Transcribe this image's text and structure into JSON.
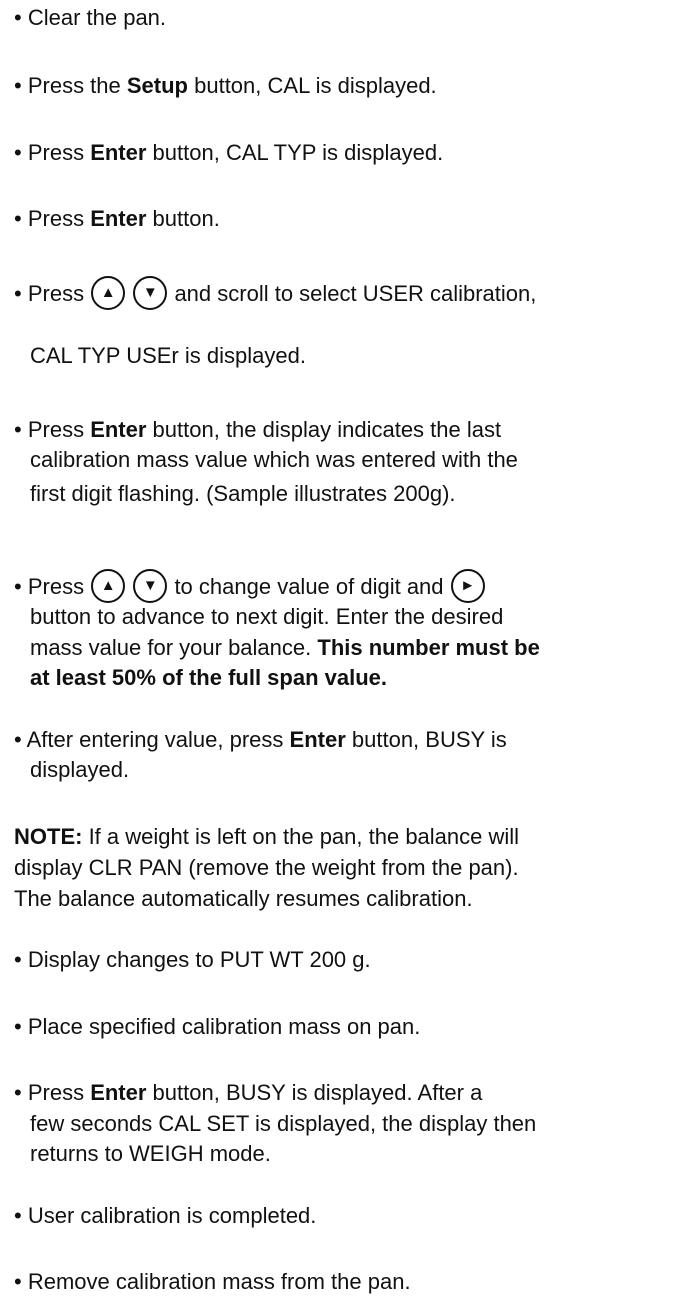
{
  "bullet": "•",
  "steps": {
    "s1": "Clear the pan.",
    "s2": {
      "pre": "Press the ",
      "bold": "Setup",
      "post": " button, CAL is displayed."
    },
    "s3": {
      "pre": "Press ",
      "bold": "Enter",
      "post": " button, CAL TYP is displayed."
    },
    "s4": {
      "pre": "Press ",
      "bold": "Enter",
      "post": " button."
    },
    "s5": {
      "pre": "Press",
      "post": " and scroll to select USER calibration,",
      "line2": "CAL TYP USEr is displayed."
    },
    "s6": {
      "pre": "Press ",
      "bold": "Enter",
      "post": " button, the display indicates the last",
      "line2": "calibration mass value which was entered with the",
      "line3": "first digit flashing. (Sample illustrates 200g)."
    },
    "s7": {
      "pre": "Press",
      "mid": " to change value of digit and",
      "line2": "button to advance to next digit.  Enter the desired",
      "line3": "mass value for your balance.  ",
      "line3_bold": "This number must be",
      "line4_bold": "at least 50% of the full span value."
    },
    "s8": {
      "pre": "After entering value, press ",
      "bold": "Enter",
      "post": " button, BUSY is",
      "line2": "displayed."
    },
    "note": {
      "label": "NOTE:",
      "line1": " If a weight is left on the pan, the balance will",
      "line2": "display CLR PAN (remove the weight from the pan).",
      "line3": "The balance automatically resumes calibration."
    },
    "s9": "Display changes to PUT WT 200 g.",
    "s10": "Place specified calibration mass on pan.",
    "s11": {
      "pre": "Press ",
      "bold": "Enter",
      "post": " button, BUSY is displayed.  After a",
      "line2": "few seconds CAL SET is displayed, the display then",
      "line3": "returns to WEIGH mode."
    },
    "s12": "User calibration is completed.",
    "s13": "Remove calibration mass from the pan."
  },
  "icons": {
    "up": "up-arrow-icon",
    "down": "down-arrow-icon",
    "right": "right-arrow-icon"
  },
  "glyphs": {
    "up": "▲",
    "down": "▼",
    "right": "►"
  }
}
